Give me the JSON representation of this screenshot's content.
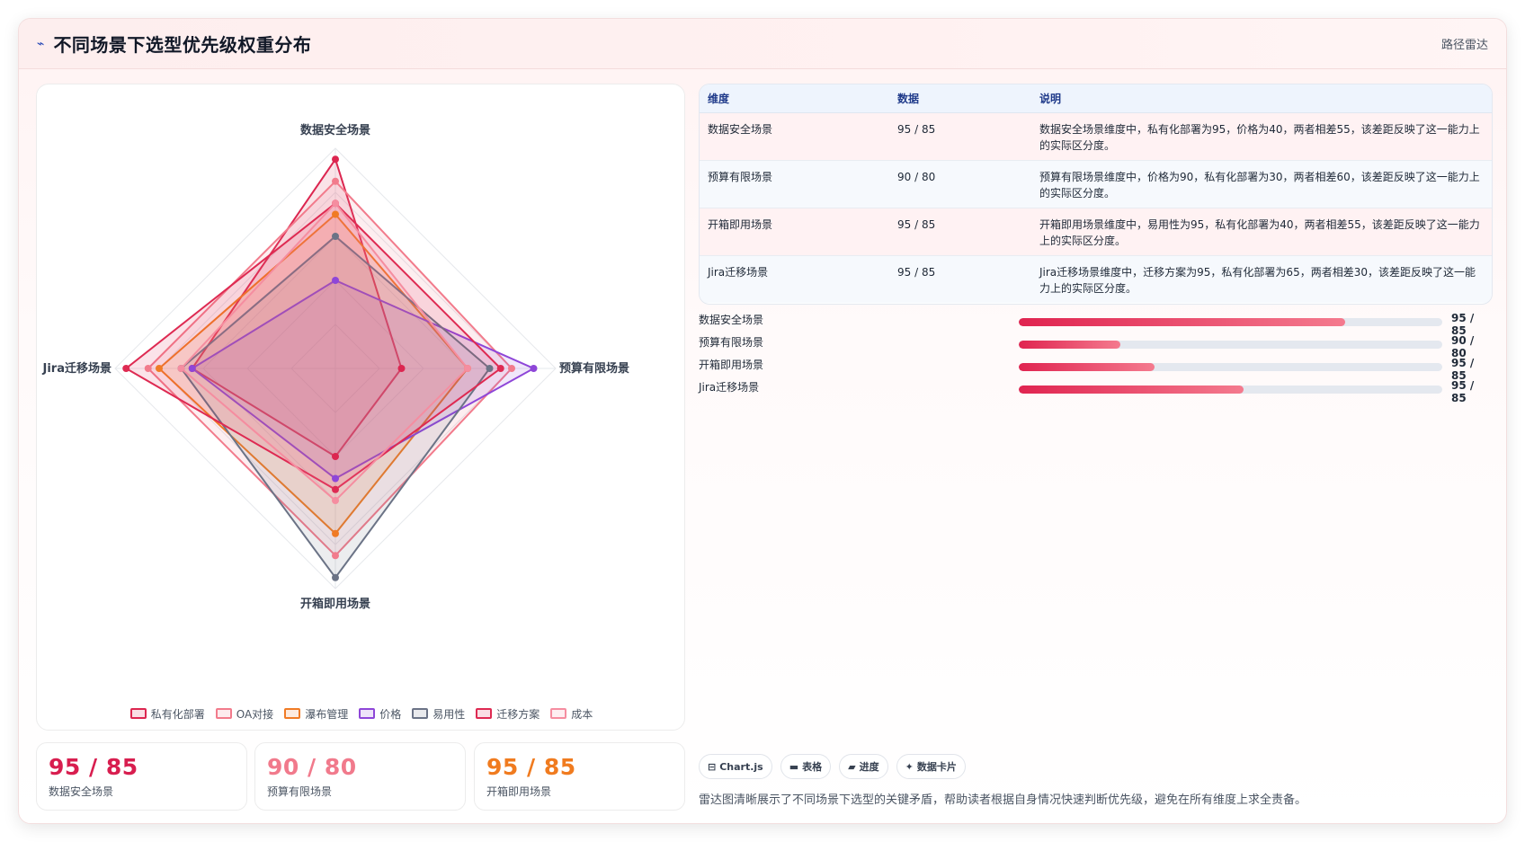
{
  "header": {
    "icon": "trend-icon",
    "title": "不同场景下选型优先级权重分布",
    "tag": "路径雷达"
  },
  "chart_data": {
    "type": "radar",
    "axes": [
      "数据安全场景",
      "预算有限场景",
      "开箱即用场景",
      "Jira迁移场景"
    ],
    "rmax": 100,
    "grid": true,
    "series": [
      {
        "name": "私有化部署",
        "color": "#dc2650",
        "values": [
          95,
          30,
          40,
          65
        ]
      },
      {
        "name": "OA对接",
        "color": "#f27b8c",
        "values": [
          85,
          80,
          85,
          85
        ]
      },
      {
        "name": "瀑布管理",
        "color": "#f07b25",
        "values": [
          70,
          60,
          75,
          80
        ]
      },
      {
        "name": "价格",
        "color": "#8e46d8",
        "values": [
          40,
          90,
          50,
          65
        ]
      },
      {
        "name": "易用性",
        "color": "#6b7386",
        "values": [
          60,
          70,
          95,
          70
        ]
      },
      {
        "name": "迁移方案",
        "color": "#de2a52",
        "values": [
          75,
          75,
          55,
          95
        ]
      },
      {
        "name": "成本",
        "color": "#f58da0",
        "values": [
          75,
          60,
          60,
          70
        ]
      }
    ]
  },
  "kpis": [
    {
      "value": "95 / 85",
      "label": "数据安全场景",
      "color": "#d81e4f"
    },
    {
      "value": "90 / 80",
      "label": "预算有限场景",
      "color": "#f17a8c"
    },
    {
      "value": "95 / 85",
      "label": "开箱即用场景",
      "color": "#f07b1f"
    }
  ],
  "table": {
    "headers": [
      "维度",
      "数据",
      "说明"
    ],
    "rows": [
      {
        "dim": "数据安全场景",
        "data": "95 / 85",
        "desc": "数据安全场景维度中，私有化部署为95，价格为40，两者相差55，该差距反映了这一能力上的实际区分度。"
      },
      {
        "dim": "预算有限场景",
        "data": "90 / 80",
        "desc": "预算有限场景维度中，价格为90，私有化部署为30，两者相差60，该差距反映了这一能力上的实际区分度。"
      },
      {
        "dim": "开箱即用场景",
        "data": "95 / 85",
        "desc": "开箱即用场景维度中，易用性为95，私有化部署为40，两者相差55，该差距反映了这一能力上的实际区分度。"
      },
      {
        "dim": "Jira迁移场景",
        "data": "95 / 85",
        "desc": "Jira迁移场景维度中，迁移方案为95，私有化部署为65，两者相差30，该差距反映了这一能力上的实际区分度。"
      }
    ]
  },
  "progress": [
    {
      "label": "数据安全场景",
      "value": "95 / 85",
      "fill": 0.77
    },
    {
      "label": "预算有限场景",
      "value": "90 / 80",
      "fill": 0.24
    },
    {
      "label": "开箱即用场景",
      "value": "95 / 85",
      "fill": 0.32
    },
    {
      "label": "Jira迁移场景",
      "value": "95 / 85",
      "fill": 0.53
    }
  ],
  "chips": [
    {
      "icon": "chart-icon",
      "glyph": "⊟",
      "label": "Chart.js"
    },
    {
      "icon": "table-icon",
      "glyph": "▬",
      "label": "表格"
    },
    {
      "icon": "progress-icon",
      "glyph": "▰",
      "label": "进度"
    },
    {
      "icon": "card-icon",
      "glyph": "✦",
      "label": "数据卡片"
    }
  ],
  "summary": "雷达图清晰展示了不同场景下选型的关键矛盾，帮助读者根据自身情况快速判断优先级，避免在所有维度上求全责备。"
}
